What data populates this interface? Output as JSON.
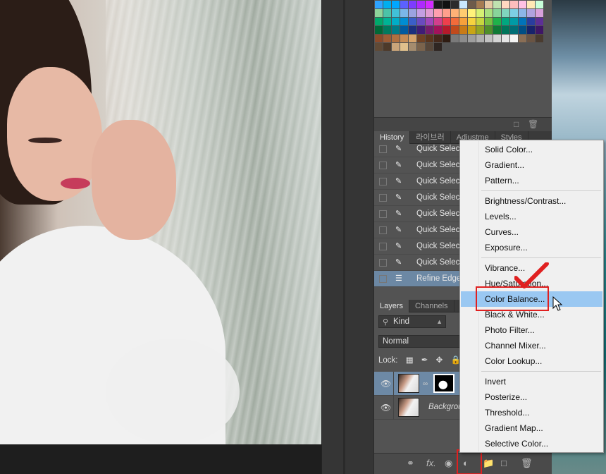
{
  "swatch_colors": [
    "#2ea3ff",
    "#00aeef",
    "#00a7ff",
    "#5b61ff",
    "#7d3cff",
    "#ae2aff",
    "#d42bff",
    "#1a1a1a",
    "#111111",
    "#2b2b2b",
    "#c9e8ff",
    "#6e5b4a",
    "#a67c52",
    "#e6c9a3",
    "#bfe1b0",
    "#ffd8c2",
    "#ffbdbd",
    "#ffc1e3",
    "#ffe8b5",
    "#c9ffd9",
    "#8ed39a",
    "#4cc3a8",
    "#41c1d8",
    "#7bb7e8",
    "#9ba3e0",
    "#c49ee2",
    "#e19cd2",
    "#ff9fae",
    "#ff9f8c",
    "#ffb176",
    "#ffcc70",
    "#fff27a",
    "#d6f173",
    "#a8e07f",
    "#88d59a",
    "#7fd6bf",
    "#7dcfe5",
    "#8cb6e8",
    "#b0a3df",
    "#d8a1db",
    "#00a86b",
    "#00b395",
    "#00adc7",
    "#008dd2",
    "#3a5fc8",
    "#6a4bbf",
    "#a046ba",
    "#d23e8c",
    "#ee3f4c",
    "#f26b3a",
    "#f7a13b",
    "#f6d33f",
    "#c7d63f",
    "#78c043",
    "#1fb24a",
    "#00a77f",
    "#009ba6",
    "#0073ba",
    "#2a3d9e",
    "#5d2f96",
    "#006837",
    "#007a5e",
    "#007b87",
    "#005aa0",
    "#1b2f7d",
    "#3f1d76",
    "#761d6c",
    "#a3125a",
    "#b61a2b",
    "#c04a1c",
    "#c97b16",
    "#c9a516",
    "#93a524",
    "#4f8f2b",
    "#0f7a36",
    "#00755a",
    "#006d75",
    "#004e85",
    "#17236b",
    "#3e1666",
    "#8a4a2a",
    "#9c5c35",
    "#b07040",
    "#c48b55",
    "#d6a36b",
    "#704224",
    "#5a351d",
    "#45281a",
    "#2f1c12",
    "#7a7a7a",
    "#8c8c8c",
    "#9e9e9e",
    "#b0b0b0",
    "#c2c2c2",
    "#d4d4d4",
    "#e6e6e6",
    "#f4f4f4",
    "#8a6e55",
    "#6a5443",
    "#4a3b2f",
    "#604a36",
    "#4d3a2a",
    "#caa57a",
    "#e0c08c",
    "#a58c6e",
    "#7a634c",
    "#57473a",
    "#2f2622"
  ],
  "swatch_footer_icons": [
    "new-swatch-icon",
    "trash-icon"
  ],
  "history_tabs": [
    "History",
    "라이브러",
    "Adjustme",
    "Styles"
  ],
  "history_items": [
    {
      "icon": "quick-selection-icon",
      "label": "Quick Selection"
    },
    {
      "icon": "quick-selection-icon",
      "label": "Quick Selection"
    },
    {
      "icon": "quick-selection-icon",
      "label": "Quick Selection"
    },
    {
      "icon": "quick-selection-icon",
      "label": "Quick Selection"
    },
    {
      "icon": "quick-selection-icon",
      "label": "Quick Selection"
    },
    {
      "icon": "quick-selection-icon",
      "label": "Quick Selection"
    },
    {
      "icon": "quick-selection-icon",
      "label": "Quick Selection"
    },
    {
      "icon": "quick-selection-icon",
      "label": "Quick Selection"
    },
    {
      "icon": "refine-edge-icon",
      "label": "Refine Edge",
      "selected": true
    }
  ],
  "layers_tabs": [
    "Layers",
    "Channels",
    "P"
  ],
  "layers": {
    "kind_label": "Kind",
    "blend_mode": "Normal",
    "lock_label": "Lock:",
    "rows": [
      {
        "name": "",
        "selected": true,
        "has_mask": true
      },
      {
        "name": "Background",
        "selected": false,
        "has_mask": false
      }
    ]
  },
  "adjustment_menu": {
    "groups": [
      [
        "Solid Color...",
        "Gradient...",
        "Pattern..."
      ],
      [
        "Brightness/Contrast...",
        "Levels...",
        "Curves...",
        "Exposure..."
      ],
      [
        "Vibrance...",
        "Hue/Saturation...",
        "Color Balance...",
        "Black & White...",
        "Photo Filter...",
        "Channel Mixer...",
        "Color Lookup..."
      ],
      [
        "Invert",
        "Posterize...",
        "Threshold...",
        "Gradient Map...",
        "Selective Color..."
      ]
    ],
    "highlighted": "Color Balance..."
  },
  "accent_colors": {
    "annotation_red": "#e02020",
    "menu_hover": "#9ac8f2",
    "selection_blue": "#6d89a5"
  }
}
